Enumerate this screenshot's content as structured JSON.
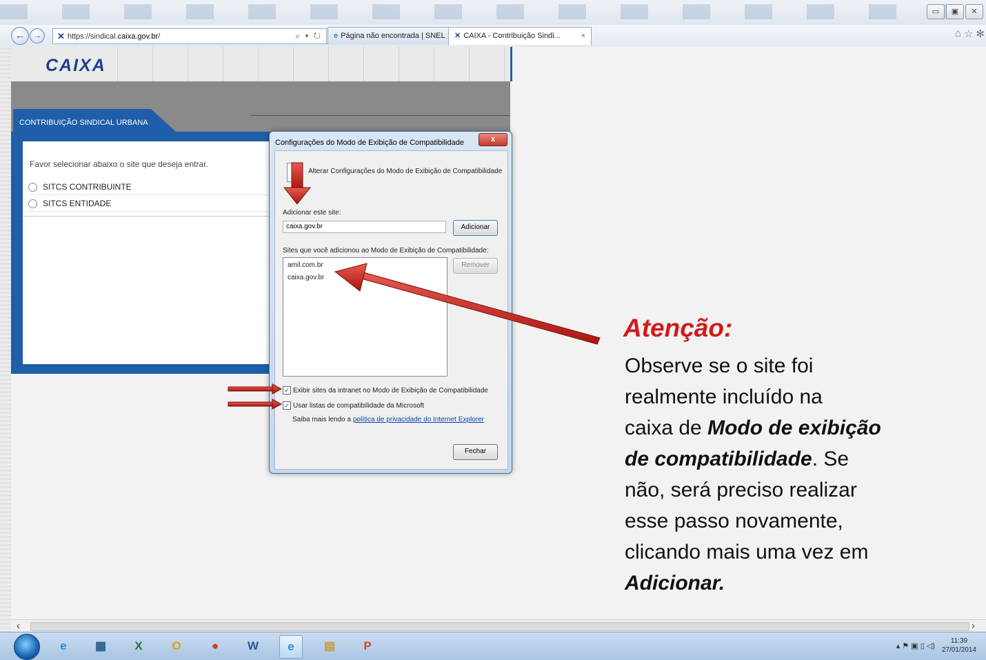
{
  "window": {
    "controls": [
      "▭",
      "▣",
      "✕"
    ]
  },
  "browser": {
    "url_prefix": "https://sindical.",
    "url_domain": "caixa.gov.br",
    "url_suffix": "/",
    "address_controls": "⌕ ▾ ↻",
    "tabs": [
      {
        "title": "Página não encontrada | SNEL",
        "icon": "ie-icon"
      },
      {
        "title": "CAIXA - Contribuição Sindi...",
        "icon": "caixa-icon",
        "close": "×"
      }
    ],
    "tools": [
      "⌂",
      "☆",
      "✻"
    ]
  },
  "page": {
    "logo": "CAIXA",
    "section_tab": "CONTRIBUIÇÃO SINDICAL URBANA",
    "prompt": "Favor selecionar abaixo o site que deseja entrar.",
    "options": [
      "SITCS CONTRIBUINTE",
      "SITCS ENTIDADE"
    ]
  },
  "dialog": {
    "title": "Configurações do Modo de Exibição de Compatibilidade",
    "close_label": "x",
    "heading": "Alterar Configurações do Modo de Exibição de Compatibilidade",
    "add_label": "Adicionar este site:",
    "site_input_value": "caixa.gov.br",
    "add_button": "Adicionar",
    "list_label": "Sites que você adicionou ao Modo de Exibição de Compatibilidade:",
    "sites": [
      "amil.com.br",
      "caixa.gov.br"
    ],
    "remove_button": "Remover",
    "checkbox_intranet": "Exibir sites da intranet no Modo de Exibição de Compatibilidade",
    "checkbox_microsoft": "Usar listas de compatibilidade da Microsoft",
    "checked_mark": "✓",
    "privacy_prefix": "Saiba mais lendo a ",
    "privacy_link": "política de privacidade do Internet Explorer",
    "close_button": "Fechar"
  },
  "annotation": {
    "title": "Atenção:",
    "line1": "Observe se o site foi",
    "line2": "realmente incluído na",
    "line3_prefix": "caixa de ",
    "line3_bold": "Modo de exibição",
    "line4_bold": "de compatibilidade",
    "line4_suffix": ".  Se",
    "line5": "não, será preciso realizar",
    "line6": "esse passo novamente,",
    "line7": "clicando mais uma vez em",
    "line8_bold": "Adicionar."
  },
  "scrollbar": {
    "left": "‹",
    "right": "›"
  },
  "taskbar": {
    "apps": [
      {
        "name": "ie-app",
        "glyph": "e",
        "color": "#2e8bd9"
      },
      {
        "name": "network-app",
        "glyph": "▦",
        "color": "#2a5d8a"
      },
      {
        "name": "excel-app",
        "glyph": "X",
        "color": "#1d7a3a"
      },
      {
        "name": "outlook-app",
        "glyph": "O",
        "color": "#e0a010"
      },
      {
        "name": "chrome-app",
        "glyph": "●",
        "color": "#d33b2c"
      },
      {
        "name": "word-app",
        "glyph": "W",
        "color": "#2b579a"
      },
      {
        "name": "ie-active-app",
        "glyph": "e",
        "color": "#2e8bd9"
      },
      {
        "name": "explorer-app",
        "glyph": "▤",
        "color": "#c89b2a"
      },
      {
        "name": "powerpoint-app",
        "glyph": "P",
        "color": "#d24726"
      }
    ],
    "tray_icons": "▴  ⚑  ▣  ▯  ◁)",
    "time": "11:39",
    "date": "27/01/2014"
  },
  "colors": {
    "accent_blue": "#1f5ea8",
    "annotation_red": "#d01b1b",
    "arrow_red": "#c0201c"
  }
}
